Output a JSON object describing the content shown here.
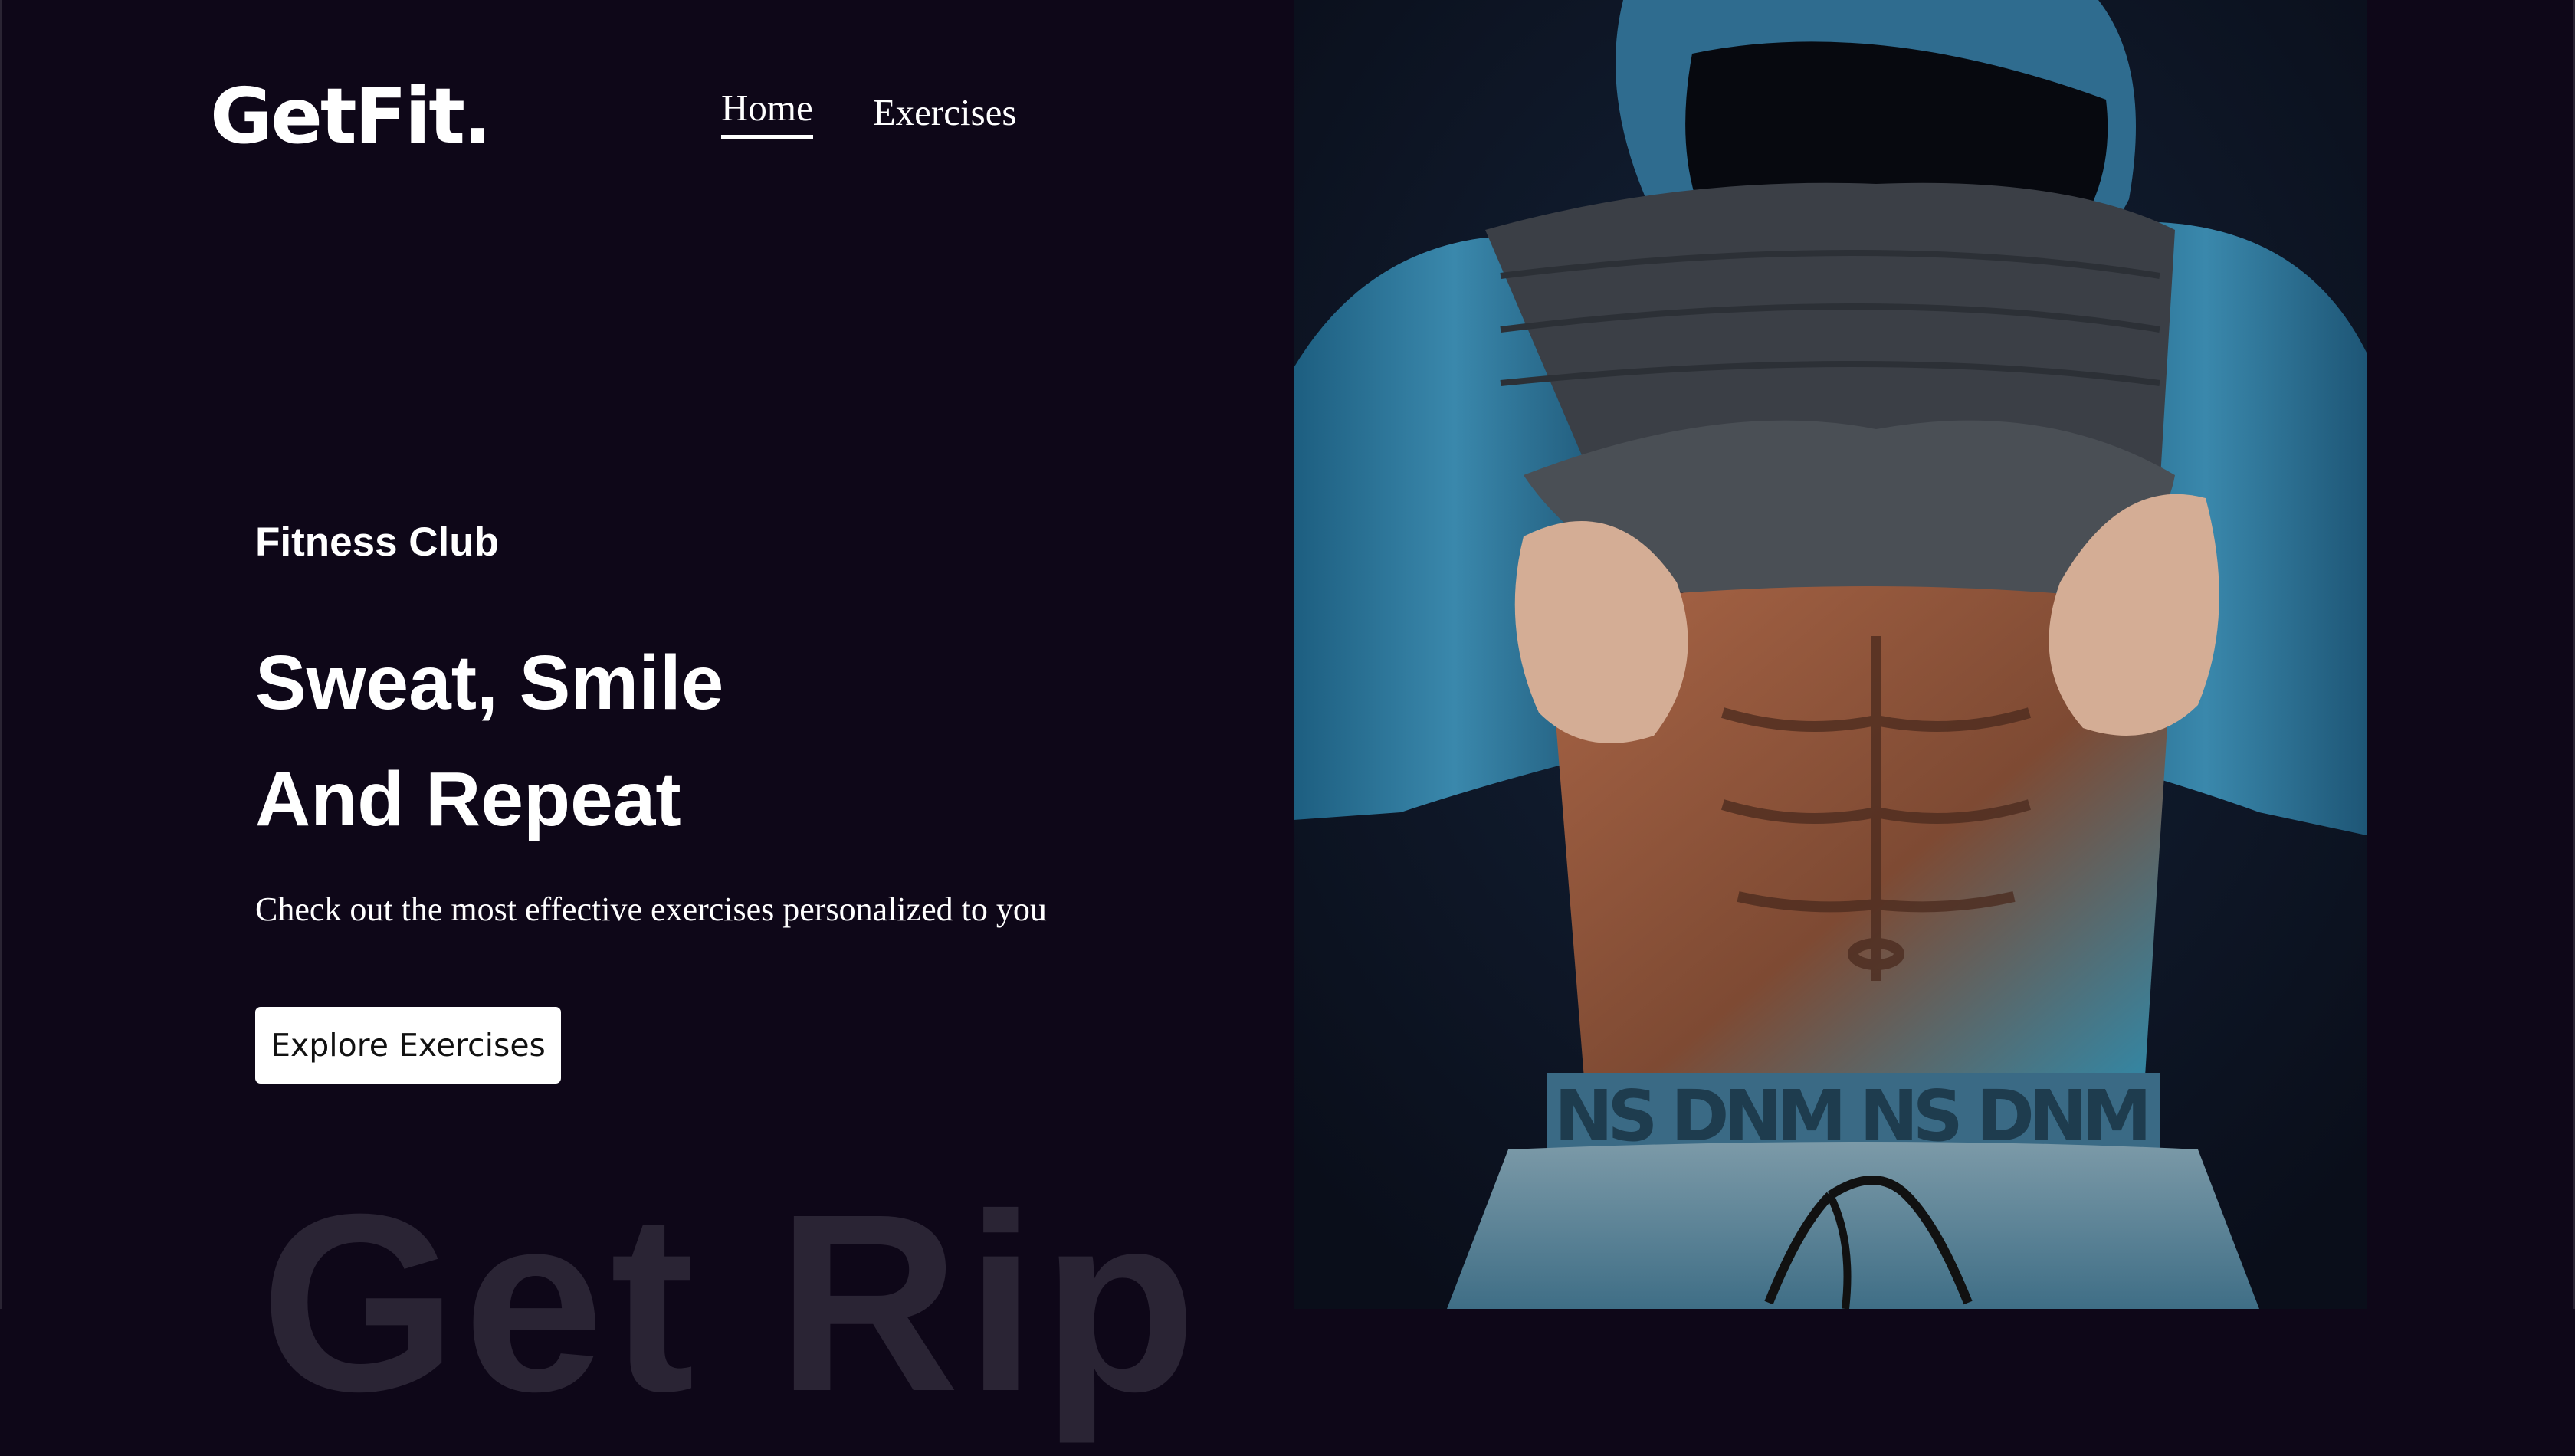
{
  "brand": {
    "logo_text": "GetFit."
  },
  "nav": {
    "items": [
      {
        "label": "Home"
      },
      {
        "label": "Exercises"
      }
    ]
  },
  "hero": {
    "eyebrow": "Fitness Club",
    "headline_line1": "Sweat, Smile",
    "headline_line2": "And Repeat",
    "subtitle": "Check out the most effective exercises personalized to you",
    "cta_label": "Explore Exercises",
    "background_word": "Get Rip",
    "image_waistband_text": "NS DNM NS DNM"
  },
  "colors": {
    "background": "#0e0718",
    "text": "#ffffff",
    "button_bg": "#ffffff",
    "button_text": "#111111",
    "ghost_text": "#2a2434"
  }
}
